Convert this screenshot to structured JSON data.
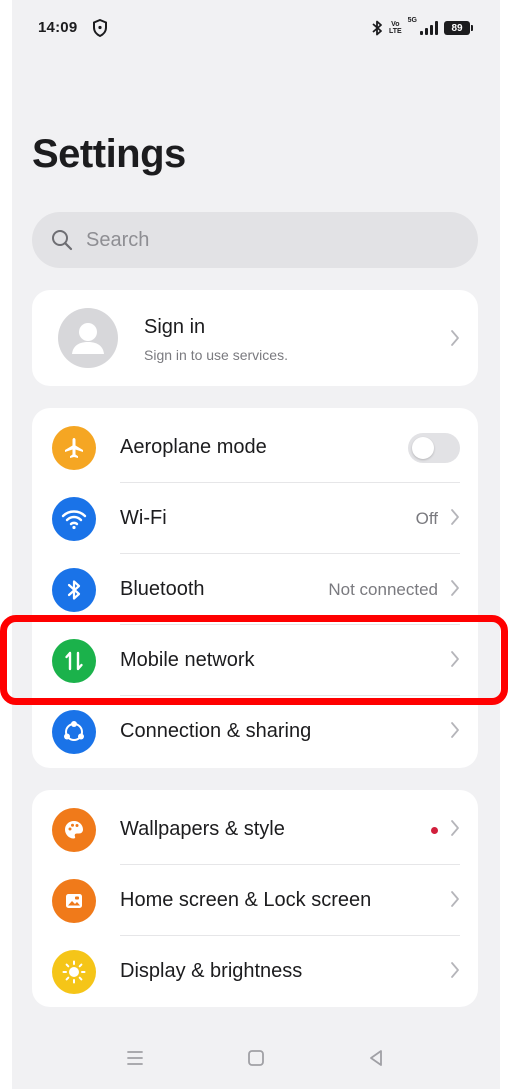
{
  "status_bar": {
    "time": "14:09",
    "volte_top": "Vo",
    "volte_bottom": "LTE",
    "network": "5G",
    "battery": "89"
  },
  "page": {
    "title": "Settings"
  },
  "search": {
    "placeholder": "Search"
  },
  "account": {
    "title": "Sign in",
    "subtitle": "Sign in to use services."
  },
  "connectivity": [
    {
      "label": "Aeroplane mode",
      "value": "",
      "icon": "airplane-icon",
      "color": "#f5a623",
      "control": "toggle",
      "toggle_on": false
    },
    {
      "label": "Wi-Fi",
      "value": "Off",
      "icon": "wifi-icon",
      "color": "#1a73e8",
      "control": "chevron"
    },
    {
      "label": "Bluetooth",
      "value": "Not connected",
      "icon": "bluetooth-icon",
      "color": "#1a73e8",
      "control": "chevron"
    },
    {
      "label": "Mobile network",
      "value": "",
      "icon": "mobile-data-icon",
      "color": "#1bb24b",
      "control": "chevron"
    },
    {
      "label": "Connection & sharing",
      "value": "",
      "icon": "connection-sharing-icon",
      "color": "#1a73e8",
      "control": "chevron"
    }
  ],
  "personalization": [
    {
      "label": "Wallpapers & style",
      "icon": "palette-icon",
      "color": "#f07a1a",
      "badge": true
    },
    {
      "label": "Home screen & Lock screen",
      "icon": "home-screen-icon",
      "color": "#f07a1a",
      "badge": false
    },
    {
      "label": "Display & brightness",
      "icon": "brightness-icon",
      "color": "#f5c518",
      "badge": false
    }
  ],
  "highlight_color": "#ff0000",
  "nav_bar": [
    "menu-icon",
    "home-icon",
    "back-icon"
  ]
}
